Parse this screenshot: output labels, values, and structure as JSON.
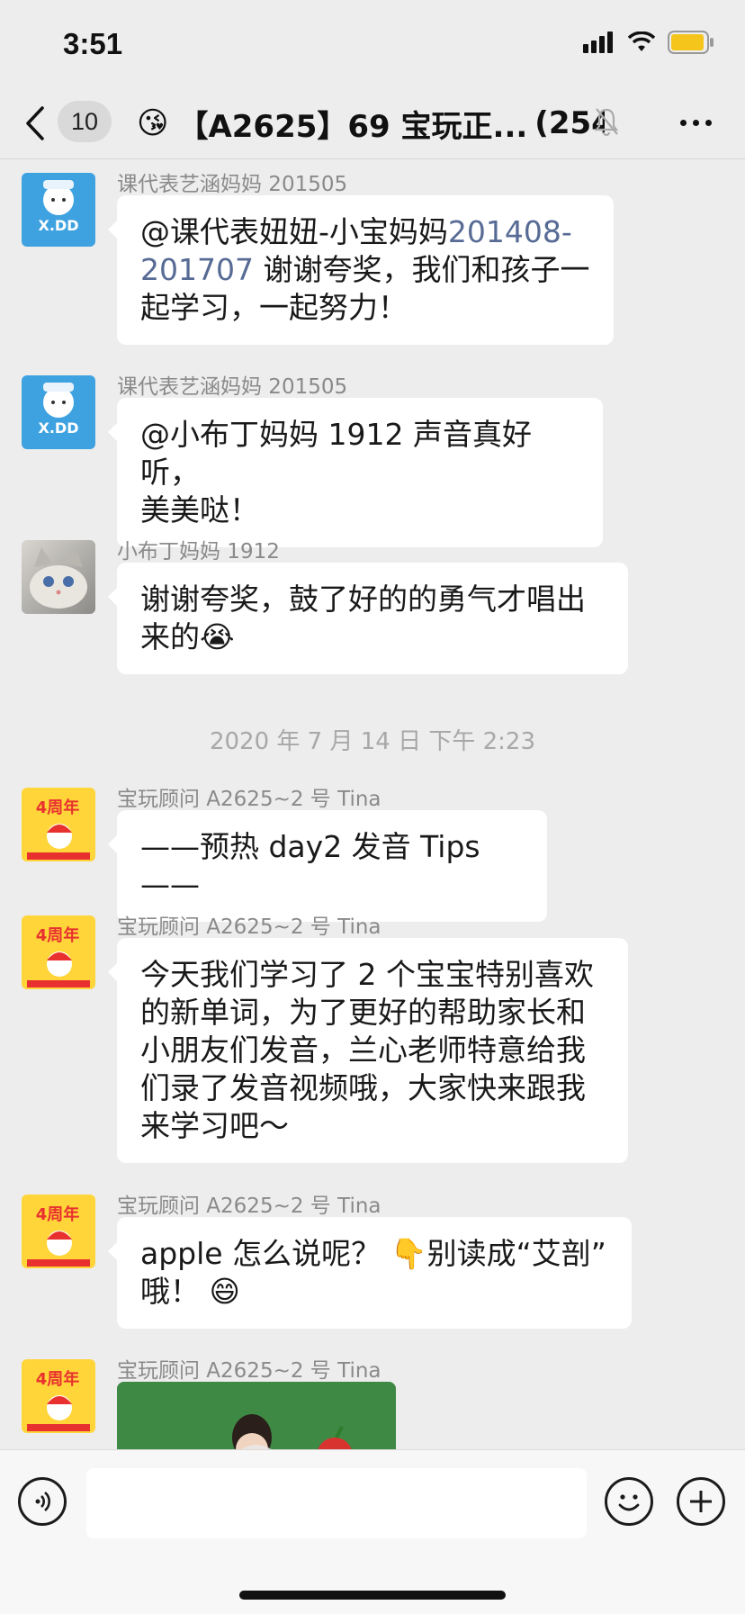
{
  "status_bar": {
    "time": "3:51"
  },
  "nav": {
    "unread_count": "10",
    "title_emoji": "😘",
    "title": "【A2625】69 宝玩正...",
    "member_count": "(254)"
  },
  "messages": [
    {
      "sender": "课代表艺涵妈妈 201505",
      "avatar": "xdd-logo",
      "lines": [
        {
          "pre": "@课代表妞妞-小宝妈妈",
          "link": "201408-"
        },
        {
          "link": "201707",
          "post": " 谢谢夸奖，我们和孩子一"
        },
        {
          "text": "起学习，一起努力！"
        }
      ]
    },
    {
      "sender": "课代表艺涵妈妈 201505",
      "avatar": "xdd-logo",
      "lines": [
        "@小布丁妈妈 1912 声音真好听，",
        "美美哒！"
      ]
    },
    {
      "sender": "小布丁妈妈 1912",
      "avatar": "cat-photo",
      "lines": [
        "谢谢夸奖，鼓了好的的勇气才唱出",
        "来的😭"
      ]
    },
    {
      "sender": "宝玩顾问 A2625~2 号 Tina",
      "avatar": "4th-anniversary",
      "lines": [
        "——预热 day2 发音 Tips——"
      ]
    },
    {
      "sender": "宝玩顾问 A2625~2 号 Tina",
      "avatar": "4th-anniversary",
      "lines": [
        "今天我们学习了 2 个宝宝特别喜欢",
        "的新单词，为了更好的帮助家长和",
        "小朋友们发音，兰心老师特意给我",
        "们录了发音视频哦，大家快来跟我",
        "来学习吧～"
      ]
    },
    {
      "sender": "宝玩顾问 A2625~2 号 Tina",
      "avatar": "4th-anniversary",
      "lines": [
        "apple 怎么说呢？ 👇别读成“艾剖”",
        "哦！ 😄"
      ]
    },
    {
      "sender": "宝玩顾问 A2625~2 号 Tina",
      "avatar": "4th-anniversary",
      "type": "video"
    }
  ],
  "time_separator": "2020 年 7 月 14 日  下午 2:23",
  "avatar_labels": {
    "xdd": "X.DD",
    "anniversary": "4周年"
  },
  "input": {
    "placeholder": ""
  },
  "colors": {
    "background": "#ededed",
    "bubble": "#ffffff",
    "link": "#576b95",
    "video_bg": "#3e8a45"
  }
}
